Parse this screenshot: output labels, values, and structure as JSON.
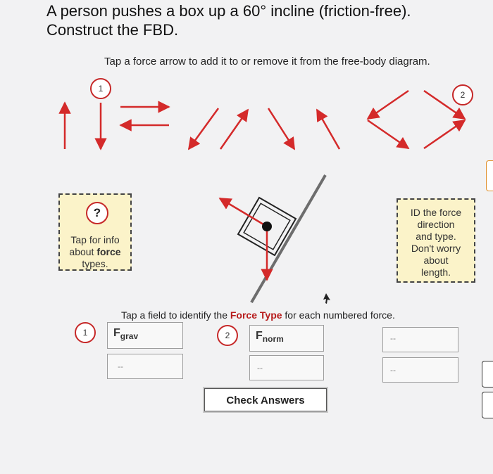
{
  "question": {
    "line1": "A person pushes a box up a 60° incline (friction-free).",
    "line2": "Construct the FBD."
  },
  "instruction": "Tap a force arrow to add it to or remove it from the free-body diagram.",
  "markers": {
    "one": "1",
    "two": "2"
  },
  "info_box": {
    "question_mark": "?",
    "line1": "Tap for info",
    "line2_prefix": "about ",
    "line2_bold": "force",
    "line3": "types."
  },
  "id_box": {
    "lines": [
      "ID the force",
      "direction",
      "and type.",
      "Don't worry",
      "about",
      "length."
    ]
  },
  "field_prompt": {
    "prefix": "Tap a field to identify the ",
    "bold": "Force Type",
    "suffix": " for each numbered force."
  },
  "fields": {
    "f1_label": "F",
    "f1_sub": "grav",
    "f2_label": "F",
    "f2_sub": "norm",
    "dash": "--"
  },
  "check_button": "Check Answers",
  "colors": {
    "arrow_red": "#d42a2a",
    "marker_red": "#c62828",
    "info_bg": "#fbf3c9",
    "incline_gray": "#6d6d6d"
  }
}
